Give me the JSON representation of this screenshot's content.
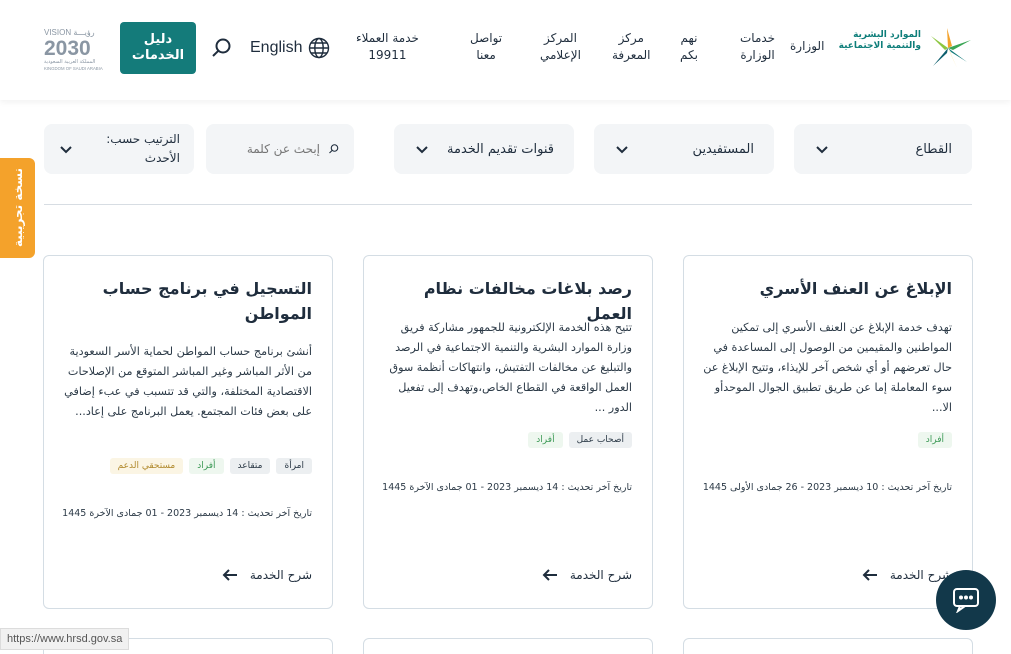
{
  "header": {
    "logo_line1": "الموارد البشرية",
    "logo_line2": "والتنمية الاجتماعية",
    "nav": [
      {
        "line1": "الوزارة",
        "line2": ""
      },
      {
        "line1": "خدمات",
        "line2": "الوزارة"
      },
      {
        "line1": "نهم",
        "line2": "بكم"
      },
      {
        "line1": "مركز",
        "line2": "المعرفة"
      },
      {
        "line1": "المركز",
        "line2": "الإعلامي"
      },
      {
        "line1": "تواصل",
        "line2": "معنا"
      },
      {
        "line1": "خدمة العملاء",
        "line2": "19911"
      }
    ],
    "language": "English",
    "guide_line1": "دليل",
    "guide_line2": "الخدمات",
    "vision_top": "VISION رؤيـــة",
    "vision_year": "2030",
    "vision_sub1": "المملكة العربية السعودية",
    "vision_sub2": "KINGDOM OF SAUDI ARABIA"
  },
  "filters": {
    "sector": "القطاع",
    "beneficiaries": "المستفيدين",
    "channels": "قنوات تقديم الخدمة",
    "search_placeholder": "إبحث عن كلمة",
    "sort_line1": "الترتيب حسب:",
    "sort_line2": "الأحدث"
  },
  "side_tag": "نسخة تجريبية",
  "cards": [
    {
      "title": "الإبلاغ عن العنف الأسري",
      "desc": "تهدف خدمة الإبلاغ عن العنف الأسري إلى تمكين المواطنين والمقيمين من الوصول إلى المساعدة في حال تعرضهم أو أي شخص آخر للإيذاء، وتتيح الإبلاغ عن سوء المعاملة إما عن طريق تطبيق الجوال الموحدأو الا...",
      "tags": [
        {
          "label": "أفراد",
          "style": "green"
        }
      ],
      "date": "تاريخ آخر تحديث : 10 ديسمبر 2023 - 26 جمادى الأولى 1445",
      "link": "شرح الخدمة"
    },
    {
      "title": "رصد بلاغات مخالفات نظام العمل",
      "desc": "تتيح هذه الخدمة الإلكترونية للجمهور مشاركة فريق وزارة الموارد البشرية والتنمية الاجتماعية في الرصد والتبليغ عن مخالفات التفتيش، وانتهاكات أنظمة سوق العمل الواقعة في القطاع الخاص،وتهدف إلى تفعيل الدور ...",
      "tags": [
        {
          "label": "أصحاب عمل",
          "style": "grey"
        },
        {
          "label": "أفراد",
          "style": "green"
        }
      ],
      "date": "تاريخ آخر تحديث : 14 ديسمبر 2023 - 01 جمادى الآخرة 1445",
      "link": "شرح الخدمة"
    },
    {
      "title": "التسجيل في برنامج حساب المواطن",
      "desc": "أنشئ برنامج حساب المواطن لحماية الأسر السعودية من الأثر المباشر وغير المباشر المتوقع من الإصلاحات الاقتصادية المختلفة، والتي قد تتسبب في عبء إضافي على بعض فئات المجتمع. يعمل البرنامج على إعاد...",
      "tags": [
        {
          "label": "امرأة",
          "style": "grey"
        },
        {
          "label": "متقاعد",
          "style": "grey"
        },
        {
          "label": "أفراد",
          "style": "green"
        },
        {
          "label": "مستحقي الدعم",
          "style": "yellow"
        }
      ],
      "date": "تاريخ آخر تحديث : 14 ديسمبر 2023 - 01 جمادى الآخرة 1445",
      "link": "شرح الخدمة"
    }
  ],
  "status_url": "https://www.hrsd.gov.sa",
  "colors": {
    "primary": "#147b7a",
    "accent_orange": "#f4a22b",
    "chat_bg": "#12384a"
  }
}
